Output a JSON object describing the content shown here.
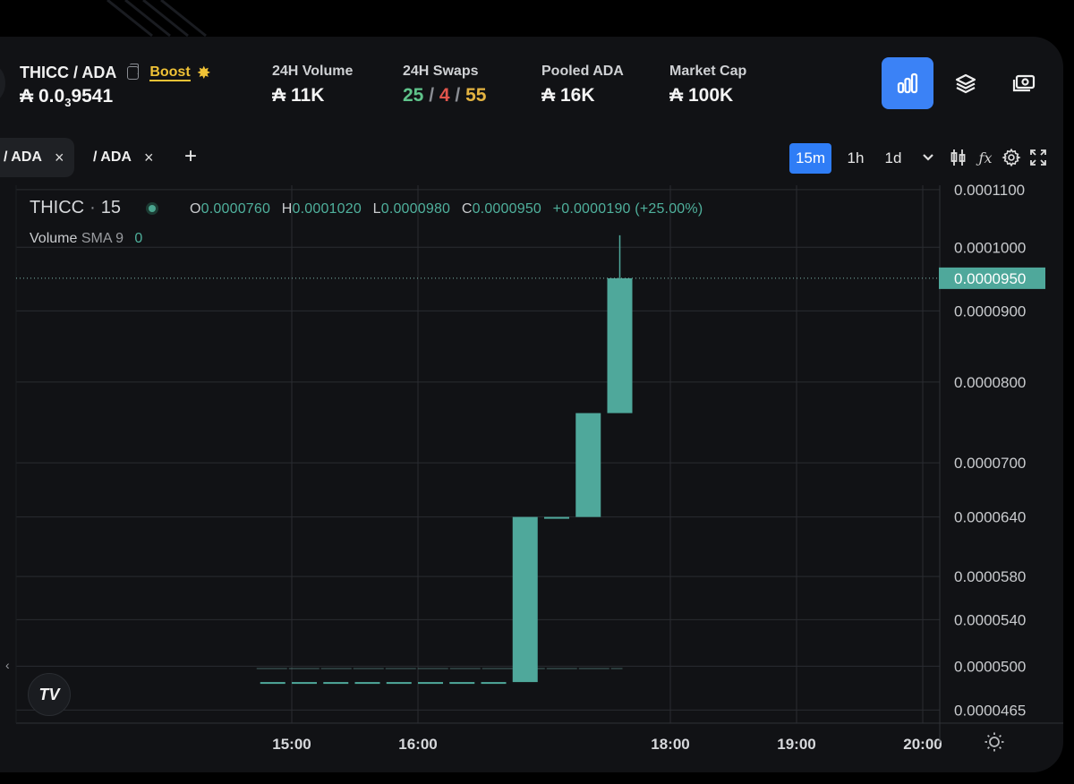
{
  "header": {
    "pair": "THICC / ADA",
    "boost_label": "Boost",
    "price_prefix": "₳ 0.0",
    "price_sub": "3",
    "price_rest": "9541",
    "stats": [
      {
        "label": "24H Volume",
        "value": "₳ 11K"
      },
      {
        "label": "24H Swaps",
        "buys": "25",
        "sells": "4",
        "total": "55"
      },
      {
        "label": "Pooled ADA",
        "value": "₳ 16K"
      },
      {
        "label": "Market Cap",
        "value": "₳ 100K"
      }
    ],
    "view_buttons": [
      "chart-view",
      "layers-view",
      "money-view"
    ]
  },
  "tabs": [
    {
      "label": "/ ADA",
      "close": "×"
    },
    {
      "label": "/ ADA",
      "close": "×"
    }
  ],
  "add_tab": "+",
  "timeframes": [
    "15m",
    "1h",
    "1d"
  ],
  "timeframe_active": "15m",
  "legend": {
    "symbol": "THICC",
    "sep": "·",
    "interval": "15",
    "o_label": "O",
    "o": "0.0000760",
    "h_label": "H",
    "h": "0.0001020",
    "l_label": "L",
    "l": "0.0000980",
    "c_label": "C",
    "c": "0.0000950",
    "change": "+0.0000190 (+25.00%)",
    "volume_label": "Volume",
    "sma_label": "SMA 9",
    "volume_value": "0"
  },
  "colors": {
    "up": "#4fa89b",
    "accent": "#2f7df6",
    "grid": "#2a2c31"
  },
  "chart_data": {
    "type": "candlestick",
    "scale": "log",
    "ylim": [
      4.55e-05,
      0.0001108
    ],
    "yticks": [
      "0.0001100",
      "0.0001000",
      "0.0000900",
      "0.0000800",
      "0.0000700",
      "0.0000640",
      "0.0000580",
      "0.0000540",
      "0.0000500",
      "0.0000465"
    ],
    "current_price": "0.0000950",
    "xticks": [
      "15:00",
      "16:00",
      "18:00",
      "19:00",
      "20:00"
    ],
    "candles": [
      {
        "t": "14:45",
        "o": 4.87e-05,
        "h": 4.87e-05,
        "l": 4.87e-05,
        "c": 4.87e-05
      },
      {
        "t": "15:00",
        "o": 4.87e-05,
        "h": 4.87e-05,
        "l": 4.87e-05,
        "c": 4.87e-05
      },
      {
        "t": "15:15",
        "o": 4.87e-05,
        "h": 4.87e-05,
        "l": 4.87e-05,
        "c": 4.87e-05
      },
      {
        "t": "15:30",
        "o": 4.87e-05,
        "h": 4.87e-05,
        "l": 4.87e-05,
        "c": 4.87e-05
      },
      {
        "t": "15:45",
        "o": 4.87e-05,
        "h": 4.87e-05,
        "l": 4.87e-05,
        "c": 4.87e-05
      },
      {
        "t": "16:00",
        "o": 4.87e-05,
        "h": 4.87e-05,
        "l": 4.87e-05,
        "c": 4.87e-05
      },
      {
        "t": "16:15",
        "o": 4.87e-05,
        "h": 4.87e-05,
        "l": 4.87e-05,
        "c": 4.87e-05
      },
      {
        "t": "16:30",
        "o": 4.87e-05,
        "h": 4.87e-05,
        "l": 4.87e-05,
        "c": 4.87e-05
      },
      {
        "t": "16:45",
        "o": 4.87e-05,
        "h": 6.4e-05,
        "l": 4.87e-05,
        "c": 6.4e-05
      },
      {
        "t": "17:00",
        "o": 6.4e-05,
        "h": 6.4e-05,
        "l": 6.4e-05,
        "c": 6.4e-05
      },
      {
        "t": "17:15",
        "o": 6.4e-05,
        "h": 7.6e-05,
        "l": 6.4e-05,
        "c": 7.6e-05
      },
      {
        "t": "17:30",
        "o": 7.6e-05,
        "h": 0.000102,
        "l": 7.6e-05,
        "c": 9.5e-05
      }
    ],
    "volume_line": 4.98e-05
  }
}
